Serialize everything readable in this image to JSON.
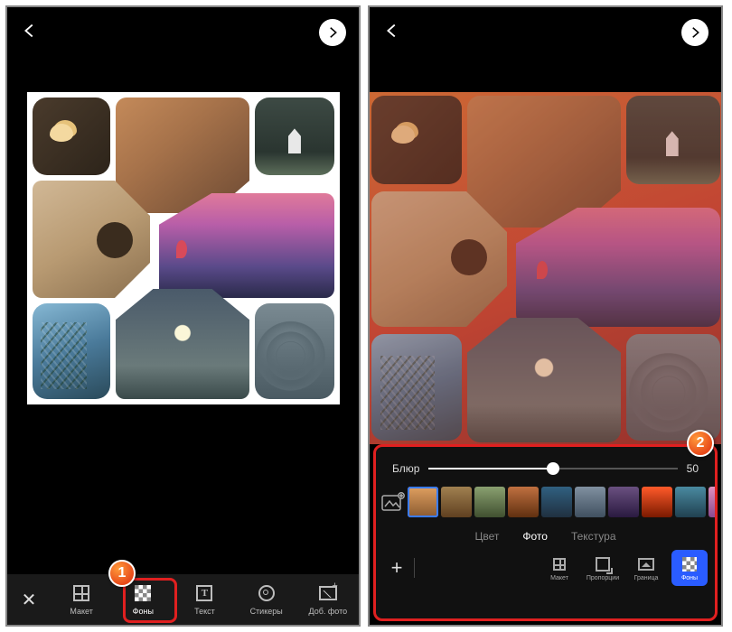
{
  "leftScreen": {
    "toolbar": {
      "closeGlyph": "✕",
      "items": [
        {
          "label": "Макет",
          "icon": "grid-icon"
        },
        {
          "label": "Фоны",
          "icon": "background-icon",
          "selected": true
        },
        {
          "label": "Текст",
          "icon": "text-icon"
        },
        {
          "label": "Стикеры",
          "icon": "sticker-icon"
        },
        {
          "label": "Доб. фото",
          "icon": "add-photo-icon"
        }
      ]
    }
  },
  "rightScreen": {
    "slider": {
      "label": "Блюр",
      "value": "50",
      "percent": 50,
      "min": 0,
      "max": 100
    },
    "tabs": [
      {
        "label": "Цвет"
      },
      {
        "label": "Фото",
        "selected": true
      },
      {
        "label": "Текстура"
      }
    ],
    "miniToolbar": {
      "plusGlyph": "+",
      "items": [
        {
          "label": "Макет",
          "icon": "grid-icon"
        },
        {
          "label": "Пропорции",
          "icon": "aspect-icon"
        },
        {
          "label": "Граница",
          "icon": "border-icon"
        },
        {
          "label": "Фоны",
          "icon": "background-icon",
          "selected": true
        }
      ]
    },
    "thumbnails": [
      "a",
      "b",
      "c",
      "d",
      "e",
      "f",
      "g",
      "h",
      "i",
      "j",
      "k"
    ],
    "thumbnailSelected": 0
  },
  "callouts": {
    "one": "1",
    "two": "2"
  }
}
